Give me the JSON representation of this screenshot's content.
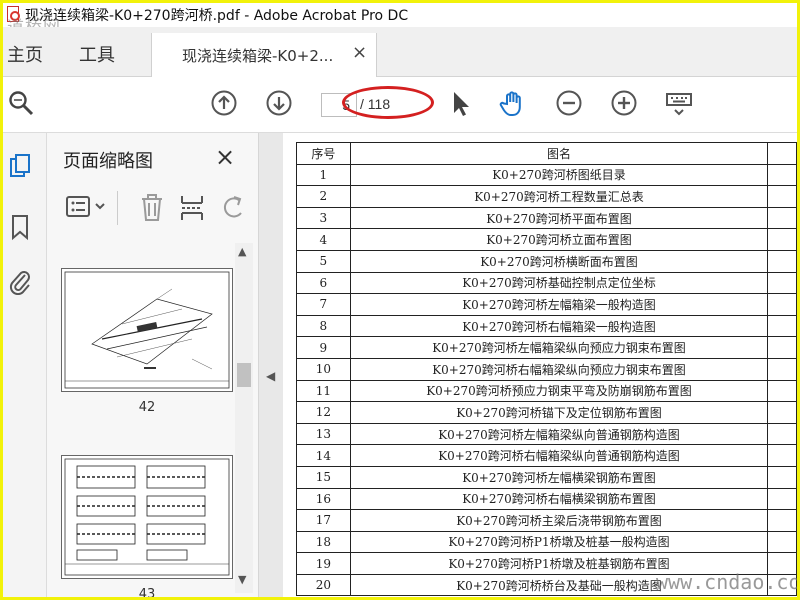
{
  "window": {
    "title": "现浇连续箱梁-K0+270跨河桥.pdf - Adobe Acrobat Pro DC",
    "watermark_top": "道桥网"
  },
  "tabs": {
    "home": "主页",
    "tools": "工具",
    "document": "现浇连续箱梁-K0+2...",
    "close_glyph": "×"
  },
  "toolbar": {
    "current_page": "5",
    "total_pages": "/ 118",
    "icons": [
      "search-zoom-icon",
      "page-up-icon",
      "page-down-icon",
      "select-arrow-icon",
      "hand-tool-icon",
      "zoom-out-icon",
      "zoom-in-icon",
      "keyboard-icon"
    ],
    "highlight_color": "#d42020",
    "accent_color": "#1a73c9"
  },
  "sidebar": {
    "title": "页面缩略图",
    "close_glyph": "×",
    "thumbnails": [
      {
        "page": "42"
      },
      {
        "page": "43"
      }
    ]
  },
  "document": {
    "headers": [
      "序号",
      "图名"
    ],
    "rows": [
      {
        "no": "1",
        "name": "K0+270跨河桥图纸目录"
      },
      {
        "no": "2",
        "name": "K0+270跨河桥工程数量汇总表"
      },
      {
        "no": "3",
        "name": "K0+270跨河桥平面布置图"
      },
      {
        "no": "4",
        "name": "K0+270跨河桥立面布置图"
      },
      {
        "no": "5",
        "name": "K0+270跨河桥横断面布置图"
      },
      {
        "no": "6",
        "name": "K0+270跨河桥基础控制点定位坐标"
      },
      {
        "no": "7",
        "name": "K0+270跨河桥左幅箱梁一般构造图"
      },
      {
        "no": "8",
        "name": "K0+270跨河桥右幅箱梁一般构造图"
      },
      {
        "no": "9",
        "name": "K0+270跨河桥左幅箱梁纵向预应力钢束布置图"
      },
      {
        "no": "10",
        "name": "K0+270跨河桥右幅箱梁纵向预应力钢束布置图"
      },
      {
        "no": "11",
        "name": "K0+270跨河桥预应力钢束平弯及防崩钢筋布置图"
      },
      {
        "no": "12",
        "name": "K0+270跨河桥锚下及定位钢筋布置图"
      },
      {
        "no": "13",
        "name": "K0+270跨河桥左幅箱梁纵向普通钢筋构造图"
      },
      {
        "no": "14",
        "name": "K0+270跨河桥右幅箱梁纵向普通钢筋构造图"
      },
      {
        "no": "15",
        "name": "K0+270跨河桥左幅横梁钢筋布置图"
      },
      {
        "no": "16",
        "name": "K0+270跨河桥右幅横梁钢筋布置图"
      },
      {
        "no": "17",
        "name": "K0+270跨河桥主梁后浇带钢筋布置图"
      },
      {
        "no": "18",
        "name": "K0+270跨河桥P1桥墩及桩基一般构造图"
      },
      {
        "no": "19",
        "name": "K0+270跨河桥P1桥墩及桩基钢筋布置图"
      },
      {
        "no": "20",
        "name": "K0+270跨河桥桥台及基础一般构造图"
      }
    ]
  },
  "watermark_bottom": "www.cndao.com"
}
